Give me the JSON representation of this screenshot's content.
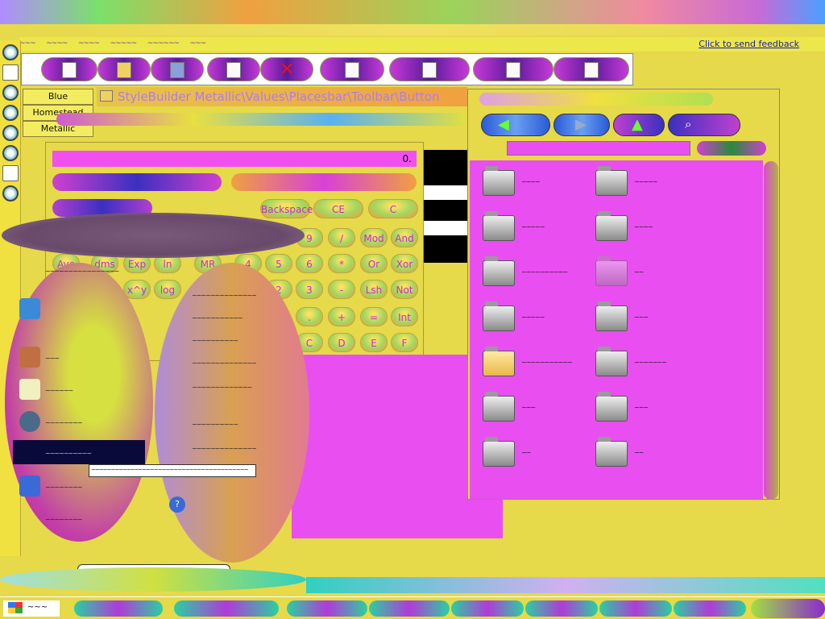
{
  "menubar": {
    "items": [
      "~~~",
      "~~~~",
      "~~~~",
      "~~~~~",
      "~~~~~~",
      "~~~"
    ]
  },
  "feedback_link": "Click to send feedback",
  "address_path": "StyleBuilder Metallic\\Values\\Placesbar\\Toolbar\\Button",
  "side_tabs": [
    "Blue",
    "Homestead",
    "Metallic"
  ],
  "calculator": {
    "display": "0.",
    "keys_row1": [
      "Backspace",
      "CE",
      "C"
    ],
    "keys_grid": [
      [
        "9",
        "/",
        "Mod",
        "And"
      ],
      [
        "5",
        "6",
        "*",
        "Or",
        "Xor"
      ],
      [
        "2",
        "3",
        "-",
        "Lsh",
        "Not"
      ],
      [
        ".",
        "+",
        "=",
        "Int"
      ],
      [
        "C",
        "D",
        "E",
        "F"
      ]
    ],
    "func_keys": [
      "Ave",
      "dms",
      "Exp",
      "ln",
      "MR",
      "4"
    ],
    "func_keys2": [
      "x^y",
      "log"
    ]
  },
  "browser": {
    "files": [
      {
        "name": "~~~~",
        "kind": "gray"
      },
      {
        "name": "~~~~~",
        "kind": "gray"
      },
      {
        "name": "~~~~~",
        "kind": "gray"
      },
      {
        "name": "~~~~",
        "kind": "gray"
      },
      {
        "name": "~~~~~~~~~~",
        "kind": "gray"
      },
      {
        "name": "~~",
        "kind": "faded"
      },
      {
        "name": "~~~~~",
        "kind": "gray"
      },
      {
        "name": "~~~",
        "kind": "gray"
      },
      {
        "name": "~~~~~~~~~~~",
        "kind": "yellow"
      },
      {
        "name": "~~~~~~~",
        "kind": "gray"
      },
      {
        "name": "~~~",
        "kind": "gray"
      },
      {
        "name": "~~~",
        "kind": "gray"
      },
      {
        "name": "~~",
        "kind": "gray"
      },
      {
        "name": "~~",
        "kind": "gray"
      }
    ]
  },
  "startmenu": {
    "left_items": [
      "~~~~~~~~~~~~~~~~",
      "~~~",
      "~~~~~~",
      "~~~~~~~~",
      "~~~~~~~~~~",
      "~~~~~~~~",
      "~~~~~~~~"
    ],
    "right_items": [
      "~~~~~~~~~~~~~~",
      "~~~~~~~~~~~",
      "~~~~~~~~~~",
      "~~~~~~~~~~~~~~",
      "~~~~~~~~~~~~~",
      "~~~~~~~~~~",
      "~~~~~~~~~~~~~~"
    ]
  },
  "tooltip_text": "~~~~~~~~~~~~~~~~~~~~~~~~~~~~~~~~~~~~~~~~",
  "tooltip2_text": "~~~~~~~~~~~~~~~~~~~~~~~~~~~~~~~~~~~",
  "taskbar": {
    "start_label": "~~~"
  }
}
